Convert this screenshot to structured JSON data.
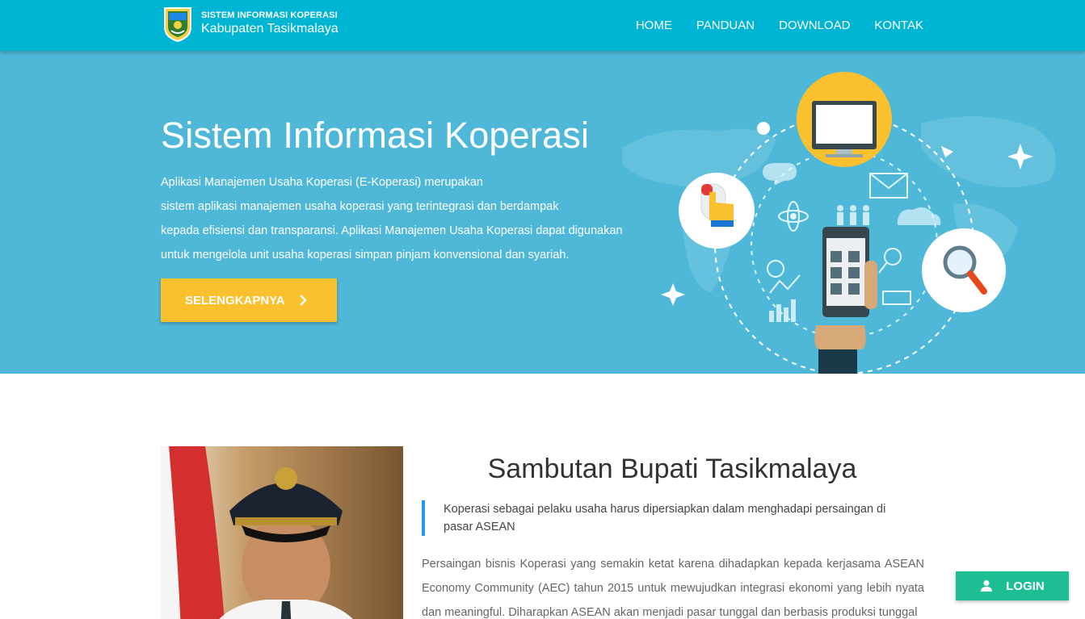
{
  "brand": {
    "line1": "SISTEM INFORMASI KOPERASI",
    "line2": "Kabupaten Tasikmalaya",
    "logo_icon": "tasikmalaya-crest-logo"
  },
  "nav": {
    "items": [
      "HOME",
      "PANDUAN",
      "DOWNLOAD",
      "KONTAK"
    ]
  },
  "hero": {
    "title": "Sistem Informasi Koperasi",
    "lines": [
      "Aplikasi Manajemen Usaha Koperasi (E-Koperasi) merupakan",
      "sistem aplikasi manajemen usaha koperasi yang terintegrasi dan berdampak",
      "kepada efisiensi dan transparansi. Aplikasi Manajemen Usaha Koperasi dapat digunakan",
      "untuk mengelola unit usaha koperasi simpan pinjam konvensional dan syariah."
    ],
    "cta_label": "SELENGKAPNYA",
    "cta_icon": "chevron-right-icon"
  },
  "section": {
    "title": "Sambutan Bupati Tasikmalaya",
    "quote": "Koperasi sebagai pelaku usaha harus dipersiapkan dalam menghadapi persaingan di pasar ASEAN",
    "body": "Persaingan bisnis Koperasi yang semakin ketat karena dihadapkan kepada kerjasama ASEAN Economy Community (AEC) tahun 2015 untuk mewujudkan integrasi ekonomi yang lebih nyata dan meaningful. Diharapkan ASEAN akan menjadi pasar tunggal dan berbasis produksi tunggal"
  },
  "login": {
    "label": "LOGIN",
    "icon": "person-icon"
  },
  "colors": {
    "navbar": "#00b4d4",
    "hero": "#4fb8d8",
    "cta": "#fbc02d",
    "login": "#1ebe95",
    "quote_border": "#2196f3"
  }
}
